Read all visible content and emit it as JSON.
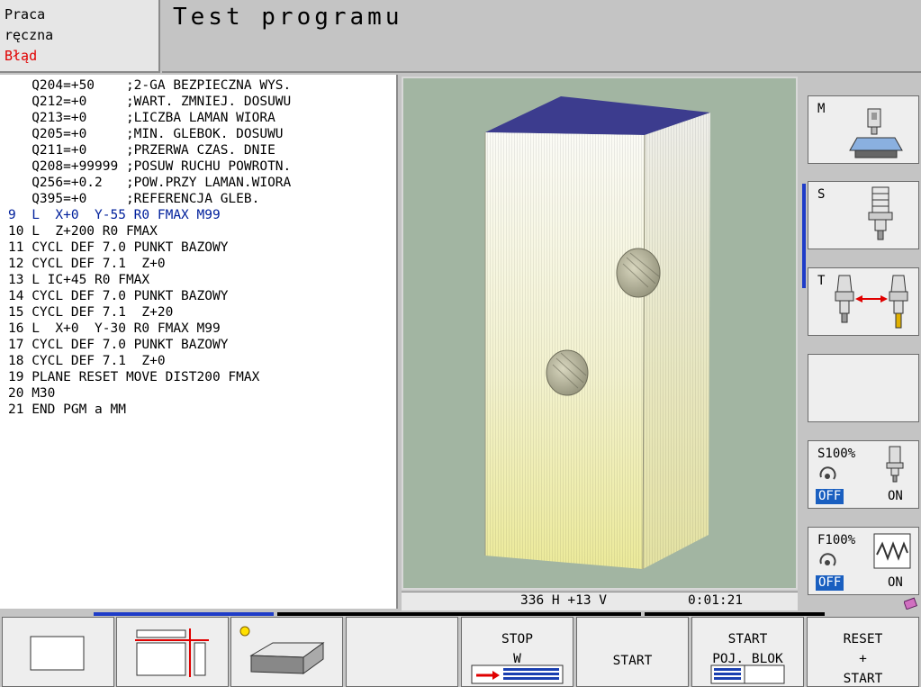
{
  "mode": {
    "line1": "Praca",
    "line2": "ręczna",
    "error": "Błąd"
  },
  "header": {
    "title": "Test programu"
  },
  "program": {
    "lines": [
      {
        "text": "   Q204=+50    ;2-GA BEZPIECZNA WYS."
      },
      {
        "text": "   Q212=+0     ;WART. ZMNIEJ. DOSUWU"
      },
      {
        "text": "   Q213=+0     ;LICZBA LAMAN WIORA"
      },
      {
        "text": "   Q205=+0     ;MIN. GLEBOK. DOSUWU"
      },
      {
        "text": "   Q211=+0     ;PRZERWA CZAS. DNIE"
      },
      {
        "text": "   Q208=+99999 ;POSUW RUCHU POWROTN."
      },
      {
        "text": "   Q256=+0.2   ;POW.PRZY LAMAN.WIORA"
      },
      {
        "text": "   Q395=+0     ;REFERENCJA GLEB."
      },
      {
        "text": "9  L  X+0  Y-55 R0 FMAX M99",
        "active": true
      },
      {
        "text": "10 L  Z+200 R0 FMAX"
      },
      {
        "text": "11 CYCL DEF 7.0 PUNKT BAZOWY"
      },
      {
        "text": "12 CYCL DEF 7.1  Z+0"
      },
      {
        "text": "13 L IC+45 R0 FMAX"
      },
      {
        "text": "14 CYCL DEF 7.0 PUNKT BAZOWY"
      },
      {
        "text": "15 CYCL DEF 7.1  Z+20"
      },
      {
        "text": "16 L  X+0  Y-30 R0 FMAX M99"
      },
      {
        "text": "17 CYCL DEF 7.0 PUNKT BAZOWY"
      },
      {
        "text": "18 CYCL DEF 7.1  Z+0"
      },
      {
        "text": "19 PLANE RESET MOVE DIST200 FMAX"
      },
      {
        "text": "20 M30"
      },
      {
        "text": "21 END PGM a MM"
      }
    ]
  },
  "status": {
    "position": "336 H +13 V",
    "time": "0:01:21"
  },
  "side_keys": {
    "m": {
      "label": "M",
      "icon": "machine-table-icon"
    },
    "s": {
      "label": "S",
      "icon": "spindle-tool-icon"
    },
    "t": {
      "label": "T",
      "icon": "tool-change-icon"
    },
    "s100": {
      "label": "S100%",
      "off": "OFF",
      "on": "ON",
      "icon": "spindle-override-icon"
    },
    "f100": {
      "label": "F100%",
      "off": "OFF",
      "on": "ON",
      "icon": "feed-override-icon"
    }
  },
  "softkeys": {
    "stop": {
      "line1": "STOP",
      "line2": "W"
    },
    "start": {
      "label": "START"
    },
    "start_block": {
      "line1": "START",
      "line2": "POJ. BLOK"
    },
    "reset_start": {
      "line1": "RESET",
      "line2": "+",
      "line3": "START"
    }
  },
  "colors": {
    "active_line": "#00209c",
    "error": "#e00000",
    "off_badge": "#1a5fc0",
    "viewport": "#a2b5a2"
  }
}
